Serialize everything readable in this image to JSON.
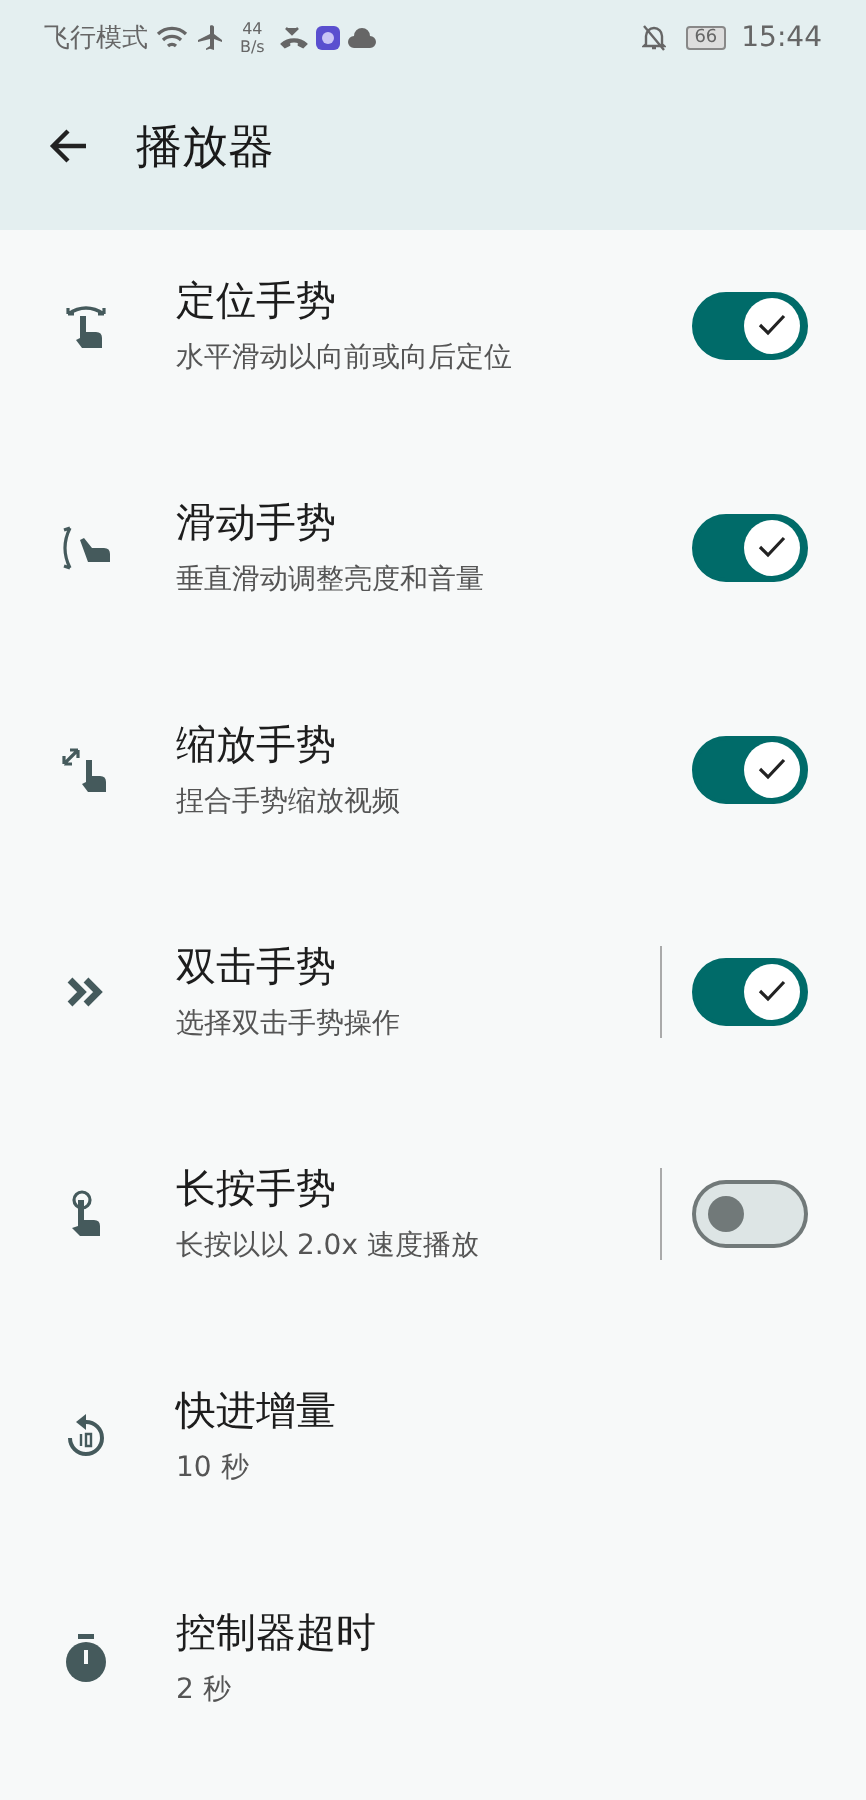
{
  "status_bar": {
    "carrier": "飞行模式",
    "speed_value": "44",
    "speed_unit": "B/s",
    "battery": "66",
    "time": "15:44"
  },
  "toolbar": {
    "title": "播放器"
  },
  "settings": [
    {
      "kind": "switch",
      "title": "定位手势",
      "subtitle": "水平滑动以向前或向后定位",
      "on": true
    },
    {
      "kind": "switch",
      "title": "滑动手势",
      "subtitle": "垂直滑动调整亮度和音量",
      "on": true
    },
    {
      "kind": "switch",
      "title": "缩放手势",
      "subtitle": "捏合手势缩放视频",
      "on": true
    },
    {
      "kind": "split-switch",
      "title": "双击手势",
      "subtitle": "选择双击手势操作",
      "on": true
    },
    {
      "kind": "split-switch",
      "title": "长按手势",
      "subtitle": "长按以以 2.0x 速度播放",
      "on": false
    },
    {
      "kind": "value",
      "title": "快进增量",
      "subtitle": "10 秒"
    },
    {
      "kind": "value",
      "title": "控制器超时",
      "subtitle": "2 秒"
    }
  ]
}
